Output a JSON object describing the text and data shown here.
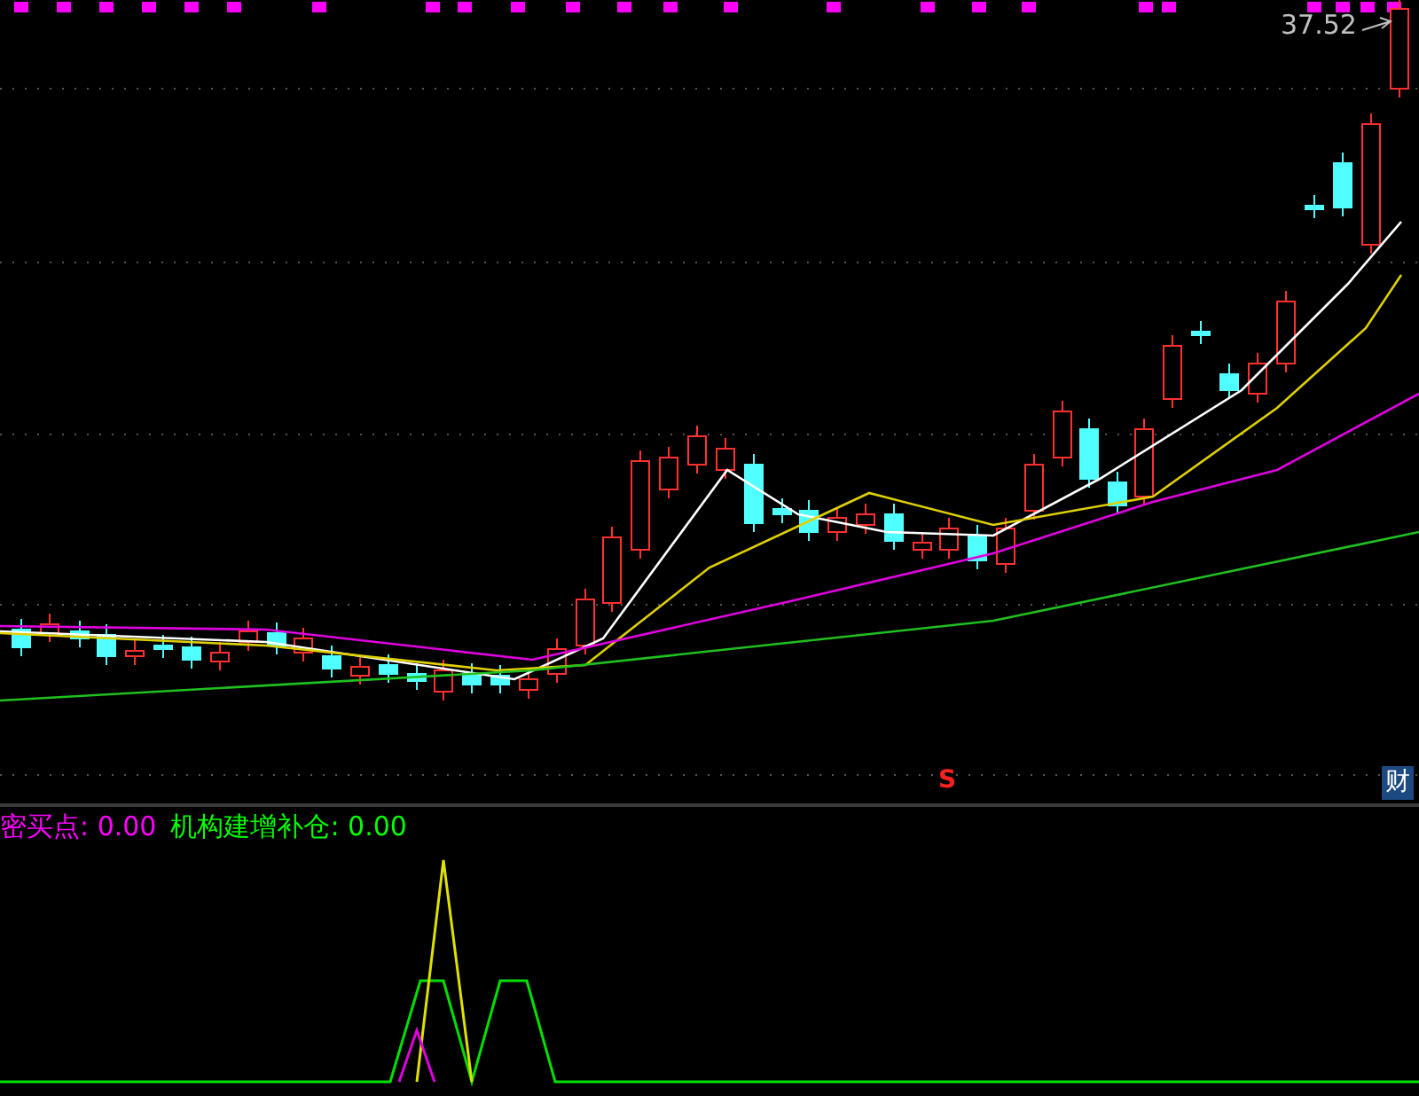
{
  "main_chart": {
    "high_label": "37.52",
    "signal_mark": "S",
    "finance_badge": "财"
  },
  "indicator": {
    "legends": [
      {
        "label": "密买点: 0.00",
        "color": "#ff00ff"
      },
      {
        "label": "机构建增补仓: 0.00",
        "color": "#00ff00"
      }
    ]
  }
}
